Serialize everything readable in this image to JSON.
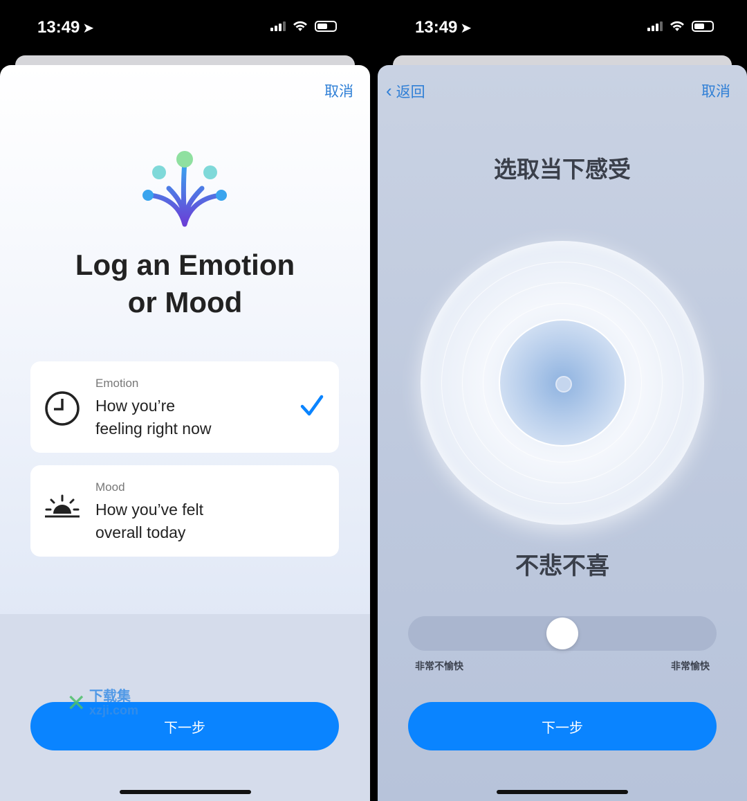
{
  "status_bar": {
    "time": "13:49"
  },
  "left_screen": {
    "cancel": "取消",
    "title_line1": "Log an Emotion",
    "title_line2": "or Mood",
    "options": [
      {
        "kind": "Emotion",
        "line1": "How you’re",
        "line2": "feeling right now",
        "icon": "clock-icon",
        "selected": true
      },
      {
        "kind": "Mood",
        "line1": "How you’ve felt",
        "line2": "overall today",
        "icon": "sunrise-icon",
        "selected": false
      }
    ],
    "next": "下一步",
    "watermark": {
      "brand": "下载集",
      "url": "xzji.com"
    }
  },
  "right_screen": {
    "back": "返回",
    "cancel": "取消",
    "heading": "选取当下感受",
    "emotion_label": "不悲不喜",
    "slider": {
      "value": 0.5,
      "min_label": "非常不愉快",
      "max_label": "非常愉快"
    },
    "next": "下一步"
  },
  "colors": {
    "accent": "#0a84ff",
    "link": "#2f7fd6"
  }
}
